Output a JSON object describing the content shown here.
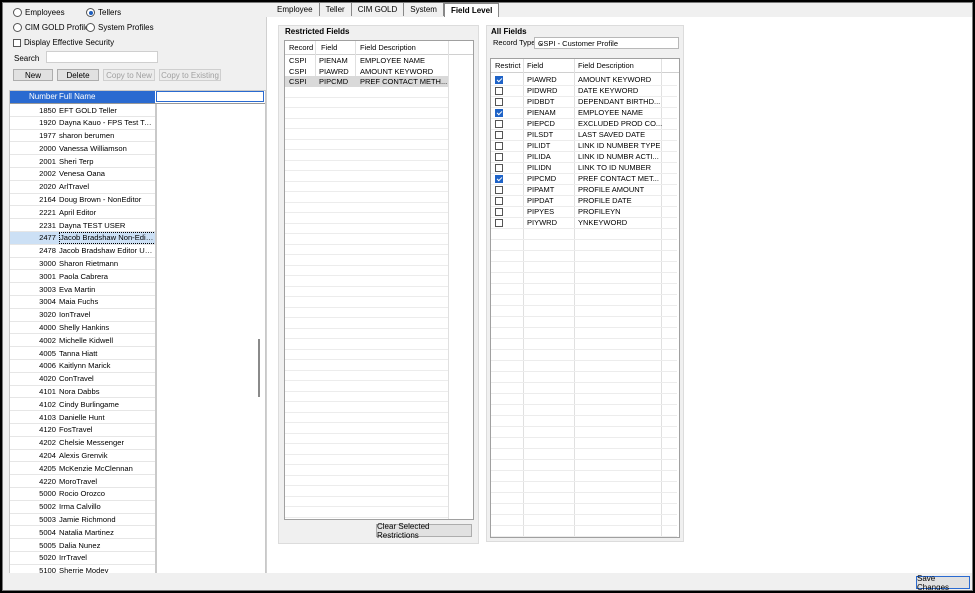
{
  "left": {
    "radios": [
      {
        "label": "Employees",
        "checked": false
      },
      {
        "label": "Tellers",
        "checked": true
      },
      {
        "label": "CIM GOLD Profiles",
        "checked": false
      },
      {
        "label": "System Profiles",
        "checked": false
      }
    ],
    "display_effective_security": "Display Effective Security",
    "search_label": "Search",
    "search_value": "",
    "buttons": {
      "new": "New",
      "delete": "Delete",
      "copy_to_new": "Copy to New",
      "copy_to_existing": "Copy to Existing"
    },
    "grid": {
      "col_number": "Number",
      "col_fullname": "Full Name",
      "rows": [
        [
          "1850",
          "EFT GOLD Teller"
        ],
        [
          "1920",
          "Dayna Kauo - FPS Test Tel..."
        ],
        [
          "1977",
          "sharon berumen"
        ],
        [
          "2000",
          "Vanessa Williamson"
        ],
        [
          "2001",
          "Sheri Terp"
        ],
        [
          "2002",
          "Venesa Oana"
        ],
        [
          "2020",
          "ArlTravel"
        ],
        [
          "2164",
          "Doug Brown - NonEditor"
        ],
        [
          "2221",
          "April Editor"
        ],
        [
          "2231",
          "Dayna TEST USER"
        ],
        [
          "2477",
          "Jacob Bradshaw Non-Edito..."
        ],
        [
          "2478",
          "Jacob Bradshaw Editor User"
        ],
        [
          "3000",
          "Sharon Rietmann"
        ],
        [
          "3001",
          "Paola Cabrera"
        ],
        [
          "3003",
          "Eva Martin"
        ],
        [
          "3004",
          "Maia Fuchs"
        ],
        [
          "3020",
          "IonTravel"
        ],
        [
          "4000",
          "Shelly Hankins"
        ],
        [
          "4002",
          "Michelle Kidwell"
        ],
        [
          "4005",
          "Tanna Hiatt"
        ],
        [
          "4006",
          "Kaitlynn Marick"
        ],
        [
          "4020",
          "ConTravel"
        ],
        [
          "4101",
          "Nora Dabbs"
        ],
        [
          "4102",
          "Cindy Burlingame"
        ],
        [
          "4103",
          "Danielle Hunt"
        ],
        [
          "4120",
          "FosTravel"
        ],
        [
          "4202",
          "Chelsie Messenger"
        ],
        [
          "4204",
          "Alexis Grenvik"
        ],
        [
          "4205",
          "McKenzie McClennan"
        ],
        [
          "4220",
          "MoroTravel"
        ],
        [
          "5000",
          "Rocio Orozco"
        ],
        [
          "5002",
          "Irma Calvillo"
        ],
        [
          "5003",
          "Jamie Richmond"
        ],
        [
          "5004",
          "Natalia Martinez"
        ],
        [
          "5005",
          "Dalia Nunez"
        ],
        [
          "5020",
          "IrrTravel"
        ],
        [
          "5100",
          "Sherrie Modey"
        ]
      ],
      "selected_number": "2477"
    }
  },
  "tabs": [
    "Employee",
    "Teller",
    "CIM GOLD",
    "System",
    "Field Level"
  ],
  "restricted": {
    "title": "Restricted Fields",
    "headers": [
      "Record",
      "Field",
      "Field Description"
    ],
    "rows": [
      [
        "CSPI",
        "PIENAM",
        "EMPLOYEE NAME"
      ],
      [
        "CSPI",
        "PIAWRD",
        "AMOUNT KEYWORD"
      ],
      [
        "CSPI",
        "PIPCMD",
        "PREF CONTACT METH..."
      ]
    ],
    "clear_button": "Clear Selected Restrictions"
  },
  "all_fields": {
    "title": "All Fields",
    "record_type_label": "Record Type",
    "record_type_value": "CSPI - Customer Profile",
    "headers": [
      "Restrict",
      "Field",
      "Field Description"
    ],
    "rows": [
      {
        "checked": true,
        "field": "PIAWRD",
        "desc": "AMOUNT KEYWORD"
      },
      {
        "checked": false,
        "field": "PIDWRD",
        "desc": "DATE KEYWORD"
      },
      {
        "checked": false,
        "field": "PIDBDT",
        "desc": "DEPENDANT BIRTHD..."
      },
      {
        "checked": true,
        "field": "PIENAM",
        "desc": "EMPLOYEE NAME"
      },
      {
        "checked": false,
        "field": "PIEPCD",
        "desc": "EXCLUDED PROD CO..."
      },
      {
        "checked": false,
        "field": "PILSDT",
        "desc": "LAST SAVED DATE"
      },
      {
        "checked": false,
        "field": "PILIDT",
        "desc": "LINK ID NUMBER TYPE"
      },
      {
        "checked": false,
        "field": "PILIDA",
        "desc": "LINK ID NUMBR ACTI..."
      },
      {
        "checked": false,
        "field": "PILIDN",
        "desc": "LINK TO ID NUMBER"
      },
      {
        "checked": true,
        "field": "PIPCMD",
        "desc": "PREF CONTACT MET..."
      },
      {
        "checked": false,
        "field": "PIPAMT",
        "desc": "PROFILE AMOUNT"
      },
      {
        "checked": false,
        "field": "PIPDAT",
        "desc": "PROFILE DATE"
      },
      {
        "checked": false,
        "field": "PIPYES",
        "desc": "PROFILEYN"
      },
      {
        "checked": false,
        "field": "PIYWRD",
        "desc": "YNKEYWORD"
      }
    ]
  },
  "save_button": "Save Changes"
}
